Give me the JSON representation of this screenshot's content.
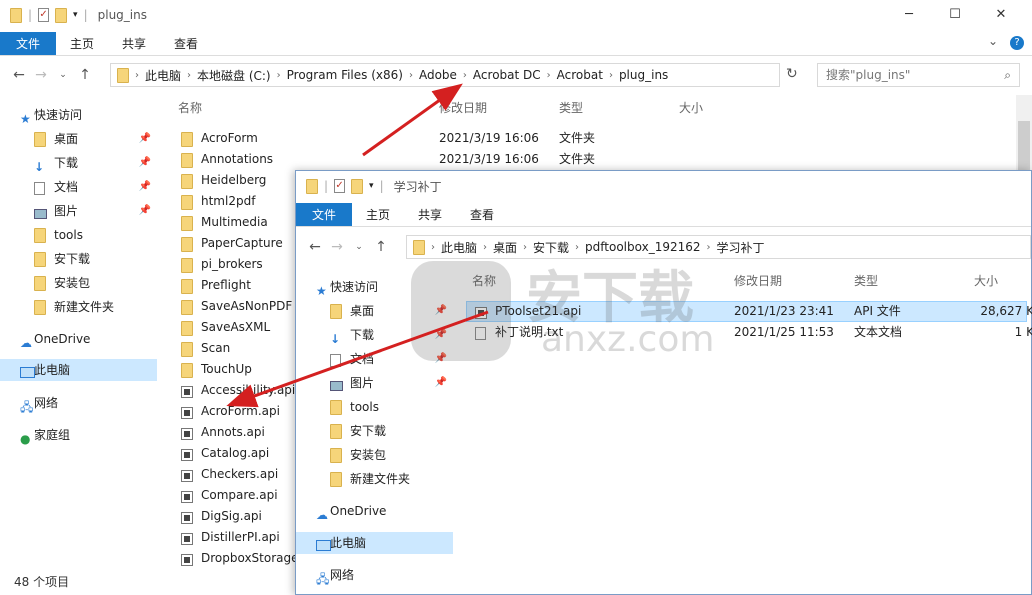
{
  "back": {
    "title": "plug_ins",
    "controls": [
      "─",
      "☐",
      "✕"
    ],
    "ribbon": [
      "文件",
      "主页",
      "共享",
      "查看"
    ],
    "breadcrumb": [
      "此电脑",
      "本地磁盘 (C:)",
      "Program Files (x86)",
      "Adobe",
      "Acrobat DC",
      "Acrobat",
      "plug_ins"
    ],
    "search_placeholder": "搜索\"plug_ins\"",
    "columns": [
      "名称",
      "修改日期",
      "类型",
      "大小"
    ],
    "sidebar": [
      {
        "label": "快速访问",
        "icon": "star-icon"
      },
      {
        "label": "桌面",
        "icon": "folder-icon",
        "pinned": true
      },
      {
        "label": "下载",
        "icon": "download-icon",
        "pinned": true
      },
      {
        "label": "文档",
        "icon": "document-icon",
        "pinned": true
      },
      {
        "label": "图片",
        "icon": "picture-icon",
        "pinned": true
      },
      {
        "label": "tools",
        "icon": "folder-icon"
      },
      {
        "label": "安下载",
        "icon": "folder-icon"
      },
      {
        "label": "安装包",
        "icon": "folder-icon"
      },
      {
        "label": "新建文件夹",
        "icon": "folder-icon"
      },
      {
        "label": "OneDrive",
        "icon": "cloud-icon"
      },
      {
        "label": "此电脑",
        "icon": "computer-icon",
        "selected": true
      },
      {
        "label": "网络",
        "icon": "network-icon"
      },
      {
        "label": "家庭组",
        "icon": "homegroup-icon"
      }
    ],
    "files": [
      {
        "name": "AcroForm",
        "date": "2021/3/19 16:06",
        "type": "文件夹",
        "kind": "folder"
      },
      {
        "name": "Annotations",
        "date": "2021/3/19 16:06",
        "type": "文件夹",
        "kind": "folder"
      },
      {
        "name": "Heidelberg",
        "kind": "folder"
      },
      {
        "name": "html2pdf",
        "kind": "folder"
      },
      {
        "name": "Multimedia",
        "kind": "folder"
      },
      {
        "name": "PaperCapture",
        "kind": "folder"
      },
      {
        "name": "pi_brokers",
        "kind": "folder"
      },
      {
        "name": "Preflight",
        "kind": "folder"
      },
      {
        "name": "SaveAsNonPDF",
        "kind": "folder"
      },
      {
        "name": "SaveAsXML",
        "kind": "folder"
      },
      {
        "name": "Scan",
        "kind": "folder"
      },
      {
        "name": "TouchUp",
        "kind": "folder"
      },
      {
        "name": "Accessibility.api",
        "kind": "api"
      },
      {
        "name": "AcroForm.api",
        "kind": "api"
      },
      {
        "name": "Annots.api",
        "kind": "api"
      },
      {
        "name": "Catalog.api",
        "kind": "api"
      },
      {
        "name": "Checkers.api",
        "kind": "api"
      },
      {
        "name": "Compare.api",
        "kind": "api"
      },
      {
        "name": "DigSig.api",
        "kind": "api"
      },
      {
        "name": "DistillerPI.api",
        "kind": "api"
      },
      {
        "name": "DropboxStorage",
        "kind": "api"
      }
    ],
    "status": "48 个项目"
  },
  "front": {
    "title": "学习补丁",
    "ribbon": [
      "文件",
      "主页",
      "共享",
      "查看"
    ],
    "breadcrumb": [
      "此电脑",
      "桌面",
      "安下载",
      "pdftoolbox_192162",
      "学习补丁"
    ],
    "columns": [
      "名称",
      "修改日期",
      "类型",
      "大小"
    ],
    "sidebar": [
      {
        "label": "快速访问",
        "icon": "star-icon"
      },
      {
        "label": "桌面",
        "icon": "folder-icon",
        "pinned": true
      },
      {
        "label": "下载",
        "icon": "download-icon",
        "pinned": true
      },
      {
        "label": "文档",
        "icon": "document-icon",
        "pinned": true
      },
      {
        "label": "图片",
        "icon": "picture-icon",
        "pinned": true
      },
      {
        "label": "tools",
        "icon": "folder-icon"
      },
      {
        "label": "安下载",
        "icon": "folder-icon"
      },
      {
        "label": "安装包",
        "icon": "folder-icon"
      },
      {
        "label": "新建文件夹",
        "icon": "folder-icon"
      },
      {
        "label": "OneDrive",
        "icon": "cloud-icon"
      },
      {
        "label": "此电脑",
        "icon": "computer-icon",
        "selected": true
      },
      {
        "label": "网络",
        "icon": "network-icon"
      }
    ],
    "files": [
      {
        "name": "PToolset21.api",
        "date": "2021/1/23 23:41",
        "type": "API 文件",
        "size": "28,627 K",
        "kind": "api",
        "selected": true
      },
      {
        "name": "补丁说明.txt",
        "date": "2021/1/25 11:53",
        "type": "文本文档",
        "size": "1 K",
        "kind": "txt"
      }
    ]
  },
  "watermark": "安下载 anxz.com",
  "colors": {
    "accent": "#1979ca",
    "selection": "#cce8ff",
    "arrow": "#d42020"
  }
}
